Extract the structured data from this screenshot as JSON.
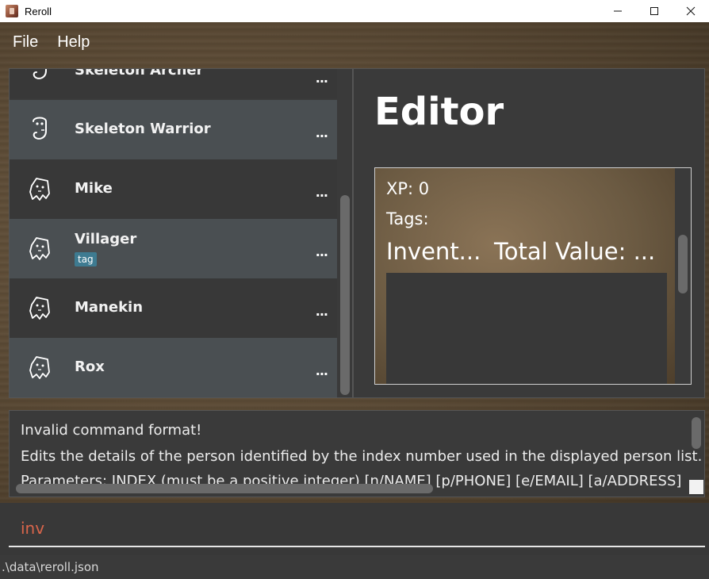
{
  "window": {
    "title": "Reroll",
    "minimize_glyph": "—",
    "maximize_glyph": "☐",
    "close_glyph": "✕"
  },
  "menu": {
    "items": [
      "File",
      "Help"
    ]
  },
  "persons": [
    {
      "name": "Skeleton Archer",
      "icon": "skeleton-icon",
      "tag": null
    },
    {
      "name": "Skeleton Warrior",
      "icon": "skeleton-icon",
      "tag": null
    },
    {
      "name": "Mike",
      "icon": "ghost-icon",
      "tag": null
    },
    {
      "name": "Villager",
      "icon": "ghost-icon",
      "tag": "tag"
    },
    {
      "name": "Manekin",
      "icon": "ghost-icon",
      "tag": null
    },
    {
      "name": "Rox",
      "icon": "ghost-icon",
      "tag": null
    }
  ],
  "person_menu_glyph": "...",
  "editor": {
    "title": "Editor",
    "xp_label": "XP: 0",
    "tags_label": "Tags:",
    "inventory_label": "Invent...",
    "total_value_label": "Total Value: ..."
  },
  "result": {
    "lines": [
      "Invalid command format!",
      "Edits the details of the person identified by the index number used in the displayed person list.",
      "Parameters: INDEX (must be a positive integer) [n/NAME] [p/PHONE] [e/EMAIL] [a/ADDRESS]"
    ]
  },
  "command": {
    "value": "inv"
  },
  "status": {
    "path": ".\\data\\reroll.json"
  },
  "colors": {
    "card_dark": "#383838",
    "card_light": "#4a4f52",
    "tag_chip": "#3e7b91",
    "command_text": "#d9654b"
  }
}
